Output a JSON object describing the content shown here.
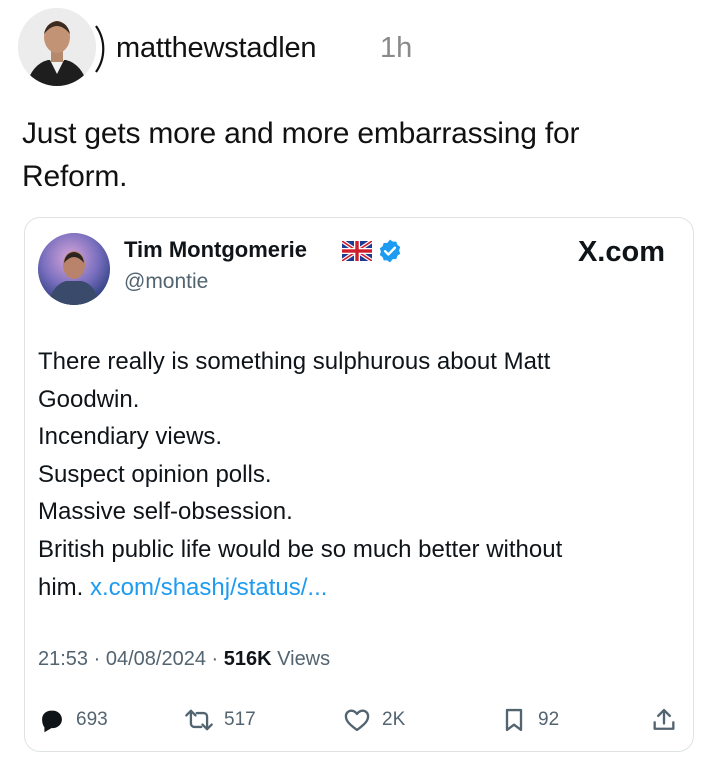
{
  "post": {
    "username": "matthewstadlen",
    "time": "1h",
    "text_lines": [
      "Just gets more and more embarrassing for",
      "Reform."
    ]
  },
  "embedded_tweet": {
    "name": "Tim Montgomerie",
    "handle": "@montie",
    "source": "X.com",
    "body_lines": [
      "There really is something sulphurous about Matt",
      "Goodwin.",
      "Incendiary views.",
      "Suspect opinion polls.",
      "Massive self-obsession.",
      "British public life would be so much better without"
    ],
    "last_line_prefix": "him.",
    "link_text": "x.com/shashj/status/...",
    "time": "21:53",
    "date": "04/08/2024",
    "views_count": "516K",
    "views_label": "Views",
    "separator": "·",
    "actions": {
      "replies": "693",
      "reposts": "517",
      "likes": "2K",
      "bookmarks": "92"
    }
  },
  "colors": {
    "link": "#1d9bf0",
    "verified": "#1d9bf0",
    "secondary_text": "#536471",
    "card_border": "#dfe3e6"
  },
  "icons": [
    "reply-icon",
    "repost-icon",
    "like-icon",
    "bookmark-icon",
    "share-icon",
    "verified-icon",
    "uk-flag-icon"
  ]
}
